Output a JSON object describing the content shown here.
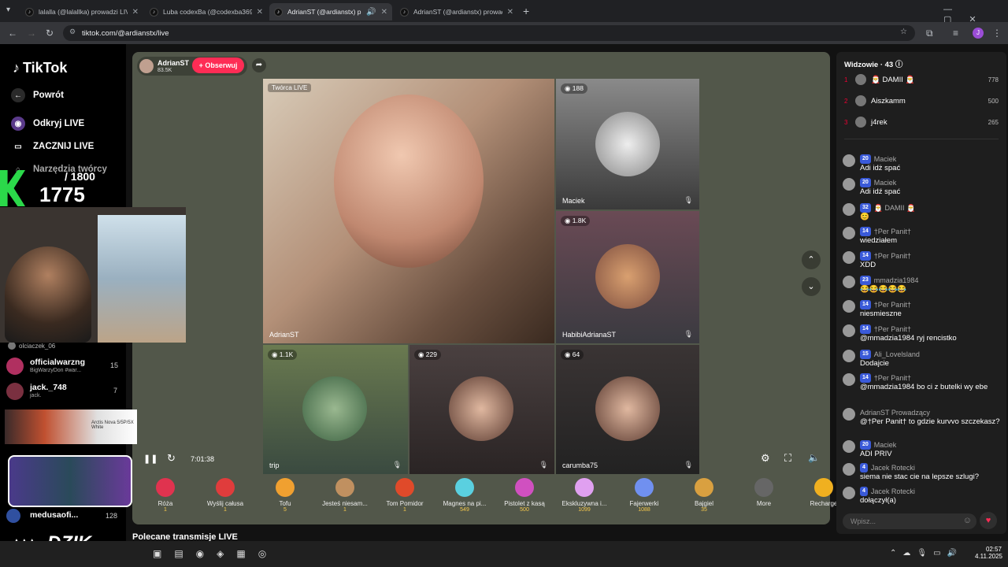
{
  "browser": {
    "tabs": [
      {
        "label": "lalalla (@lalallka) prowadzi LIVE",
        "active": false
      },
      {
        "label": "Luba codexBa (@codexba369) ...",
        "active": false
      },
      {
        "label": "AdrianST (@ardianstx) prow...",
        "active": true
      },
      {
        "label": "AdrianST (@ardianstx) prowadz...",
        "active": false
      }
    ],
    "url": "tiktok.com/@ardianstx/live"
  },
  "sidebar": {
    "logo": "TikTok",
    "back": "Powrót",
    "discover": "Odkryj LIVE",
    "start": "ZACZNIJ LIVE",
    "tools": "Narzędzia twórcy",
    "accounts": [
      {
        "name": "olciaczek_06",
        "sub": "",
        "count": ""
      },
      {
        "name": "officialwarzng",
        "sub": "BigWarzyDon #war...",
        "count": "15"
      },
      {
        "name": "jack._748",
        "sub": "jack.",
        "count": "7"
      },
      {
        "name": "medusaofi...",
        "sub": "",
        "count": "128"
      }
    ]
  },
  "stream": {
    "host": "AdrianST",
    "host_likes": "83.5K",
    "follow": "+ Obserwuj",
    "creator_tag": "Twórca LIVE",
    "time": "7:01:38",
    "tiles": [
      {
        "name": "AdrianST",
        "count": ""
      },
      {
        "name": "Maciek",
        "count": "188"
      },
      {
        "name": "HabibiAdrianaST",
        "count": "1.8K"
      },
      {
        "name": "trip",
        "count": "1.1K"
      },
      {
        "name": "",
        "count": "229"
      },
      {
        "name": "carumba75",
        "count": "64"
      }
    ]
  },
  "gifts": [
    {
      "name": "Róża",
      "price": "1",
      "color": "#e0334f"
    },
    {
      "name": "Wyślij całusa",
      "price": "1",
      "color": "#e03c3c"
    },
    {
      "name": "Tofu",
      "price": "5",
      "color": "#f0a030"
    },
    {
      "name": "Jesteś niesam...",
      "price": "1",
      "color": "#c09060"
    },
    {
      "name": "Tom Pomidor",
      "price": "1",
      "color": "#e04a2a"
    },
    {
      "name": "Magnes na pi...",
      "price": "549",
      "color": "#5ad0e0"
    },
    {
      "name": "Pistolet z kasą",
      "price": "500",
      "color": "#d050c0"
    },
    {
      "name": "Ekskluzywna i...",
      "price": "1099",
      "color": "#e0a0f0"
    },
    {
      "name": "Fajerwerki",
      "price": "1088",
      "color": "#7090f0"
    },
    {
      "name": "Bajgiel",
      "price": "35",
      "color": "#d9a040"
    },
    {
      "name": "More",
      "price": "",
      "color": "#666"
    },
    {
      "name": "Recharge",
      "price": "",
      "color": "#f0b020"
    }
  ],
  "chat": {
    "viewers_title": "Widzowie · 43",
    "top_viewers": [
      {
        "rank": "1",
        "name": "🎅 DAMII 🎅",
        "points": "778"
      },
      {
        "rank": "2",
        "name": "Aiszkamm",
        "points": "500"
      },
      {
        "rank": "3",
        "name": "j4rek",
        "points": "265"
      }
    ],
    "messages": [
      {
        "level": "20",
        "user": "Maciek",
        "text": "Adi idż spać"
      },
      {
        "level": "20",
        "user": "Maciek",
        "text": "Adi idź spać"
      },
      {
        "level": "32",
        "user": "🎅 DAMII 🎅",
        "text": "😊"
      },
      {
        "level": "14",
        "user": "†Per Panit†",
        "text": "wiedziałem"
      },
      {
        "level": "14",
        "user": "†Per Panit†",
        "text": "XDD"
      },
      {
        "level": "23",
        "user": "mmadzia1984",
        "text": "😂😂😂😂😂"
      },
      {
        "level": "14",
        "user": "†Per Panit†",
        "text": "niesmieszne"
      },
      {
        "level": "14",
        "user": "†Per Panit†",
        "text": "@mmadzia1984 ryj rencistko"
      },
      {
        "level": "15",
        "user": "Ali_Lovelsland",
        "text": "Dodajcie"
      },
      {
        "level": "14",
        "user": "†Per Panit†",
        "text": "@mmadzia1984 bo ci z butelki wy ebe"
      },
      {
        "level": "",
        "user": "AdrianST Prowadzący",
        "text": "@†Per Panit† to gdzie kurvvo szczekasz?"
      },
      {
        "level": "20",
        "user": "Maciek",
        "text": "ADI PRIV"
      },
      {
        "level": "4",
        "user": "Jacek Rotecki",
        "text": "siema nie stac cie na lepsze szlugi?"
      },
      {
        "level": "4",
        "user": "Jacek Rotecki",
        "text": "dołączył(a)"
      }
    ],
    "input_placeholder": "Wpisz..."
  },
  "overlay": {
    "counter_total": "/ 1800",
    "counter_value": "1775",
    "brand": "DZIK",
    "ad_text": "Arctis Nova 5/5P/5X White"
  },
  "section_title": "Polecane transmisje LIVE",
  "taskbar": {
    "time": "02:57",
    "date": "4.11.2025"
  }
}
